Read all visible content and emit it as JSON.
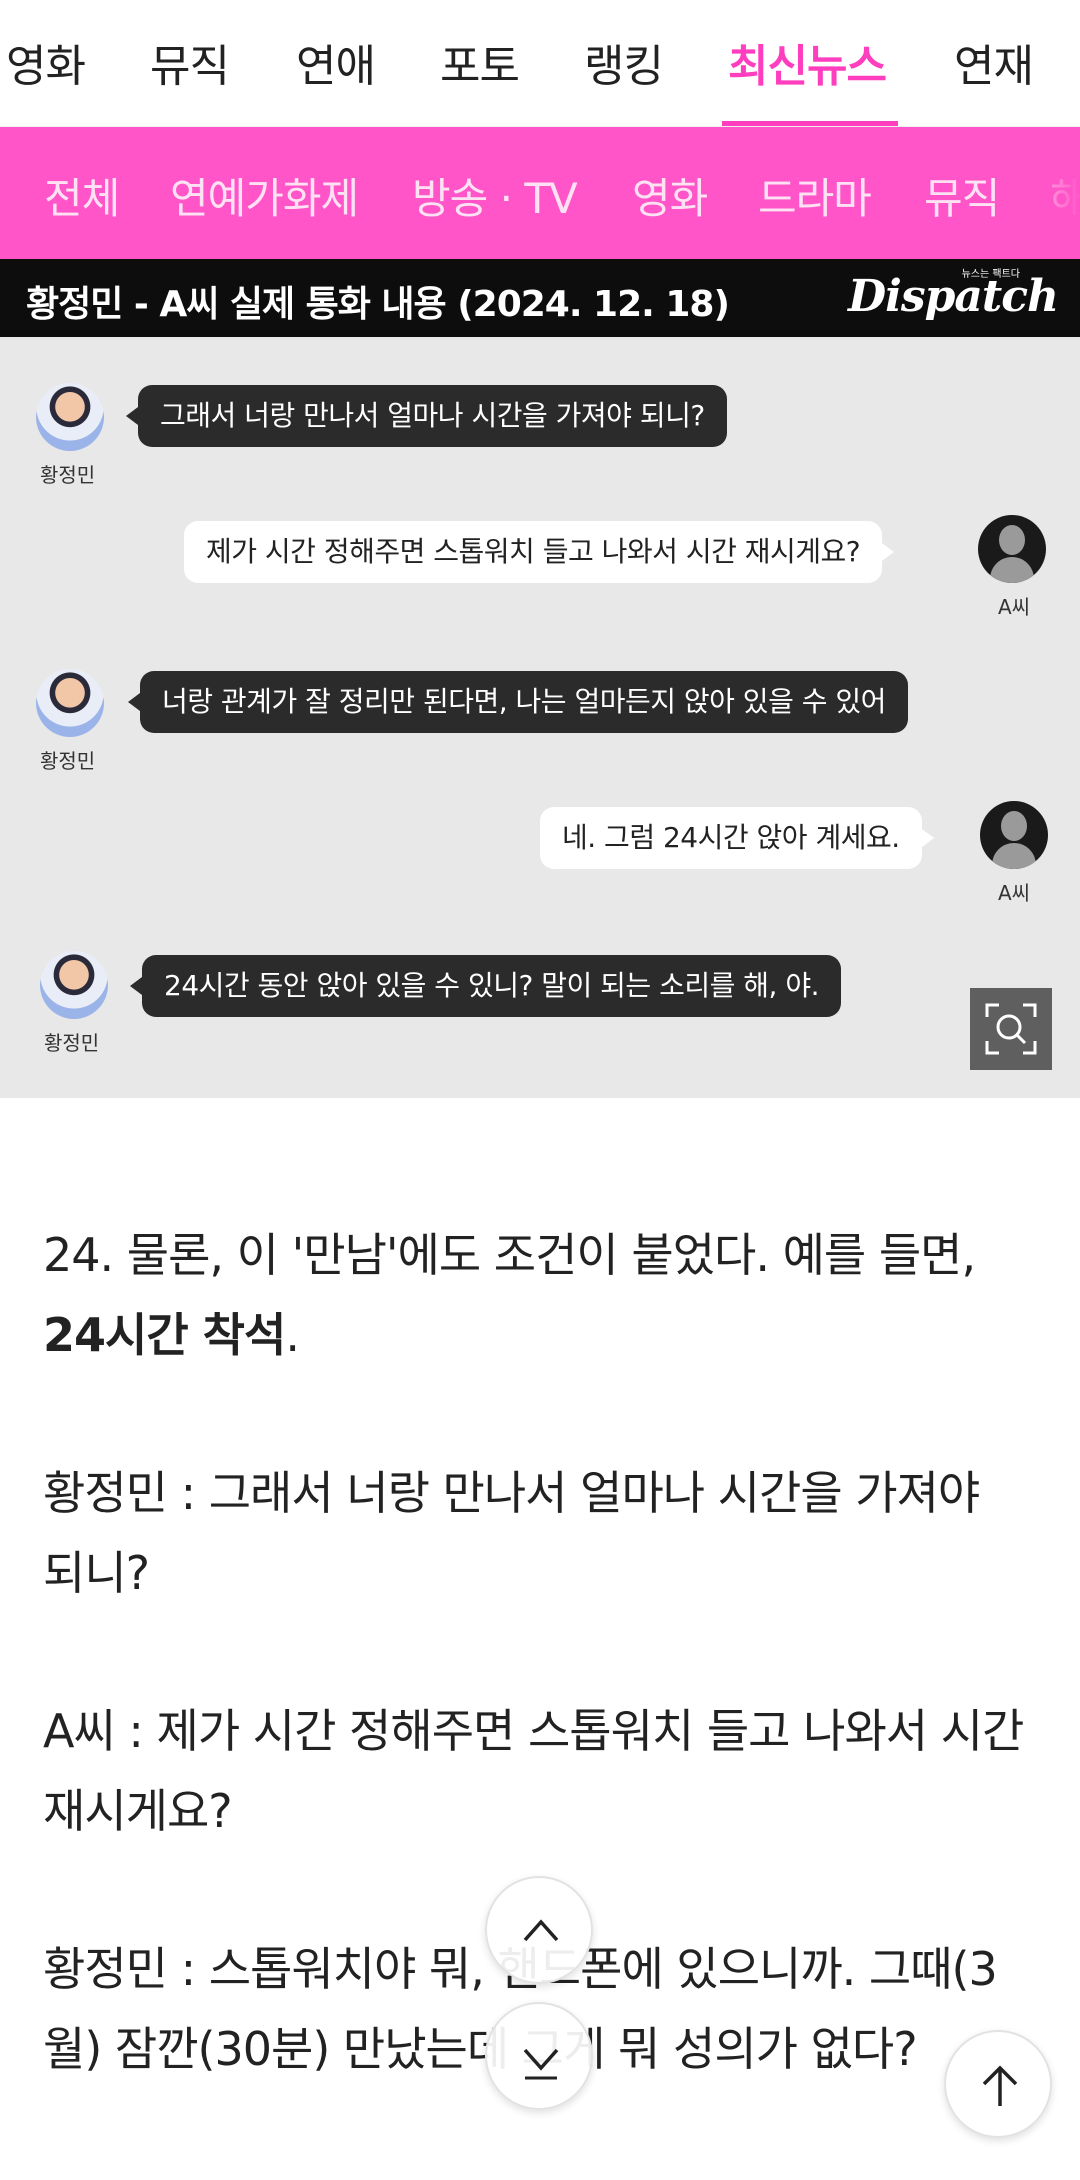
{
  "top_nav": {
    "items": [
      "영화",
      "뮤직",
      "연애",
      "포토",
      "랭킹",
      "최신뉴스",
      "연재"
    ],
    "active": "최신뉴스",
    "accent_color": "#ff3ebf"
  },
  "sub_nav": {
    "items": [
      "전체",
      "연예가화제",
      "방송 · TV",
      "영화",
      "드라마",
      "뮤직",
      "해"
    ],
    "background_color": "#ff55c8"
  },
  "figure": {
    "title": "황정민 - A씨 실제 통화 내용 (2024. 12. 18)",
    "logo": "Dispatch",
    "logo_small": "뉴스는 팩트다",
    "messages": [
      {
        "speaker": "황정민",
        "side": "left",
        "text": "그래서 너랑 만나서 얼마나 시간을 가져야 되니?"
      },
      {
        "speaker": "A씨",
        "side": "right",
        "text": "제가 시간 정해주면 스톱워치 들고 나와서 시간 재시게요?"
      },
      {
        "speaker": "황정민",
        "side": "left",
        "text": "너랑 관계가 잘 정리만 된다면, 나는 얼마든지 앉아 있을 수 있어"
      },
      {
        "speaker": "A씨",
        "side": "right",
        "text": "네. 그럼 24시간 앉아 계세요."
      },
      {
        "speaker": "황정민",
        "side": "left",
        "text": "24시간 동안 앉아 있을 수 있니? 말이 되는 소리를 해, 야."
      }
    ],
    "zoom_icon": "zoom-search-icon"
  },
  "article": {
    "p1_text": "24. 물론, 이 '만남'에도 조건이 붙었다. 예를 들면, ",
    "p1_bold": "24시간 착석",
    "p1_end": ".",
    "p2": "황정민 : 그래서 너랑 만나서 얼마나 시간을 가져야 되니?",
    "p3": "A씨 : 제가 시간 정해주면 스톱워치 들고 나와서 시간 재시게요?",
    "p4": "황정민 : 스톱워치야 뭐, 핸드폰에 있으니까. 그때(3월) 잠깐(30분) 만났는데 그게 뭐 성의가 없다?"
  },
  "buttons": {
    "scroll_up_icon": "chevron-up-icon",
    "scroll_down_icon": "chevron-down-icon",
    "top_icon": "arrow-up-icon"
  }
}
